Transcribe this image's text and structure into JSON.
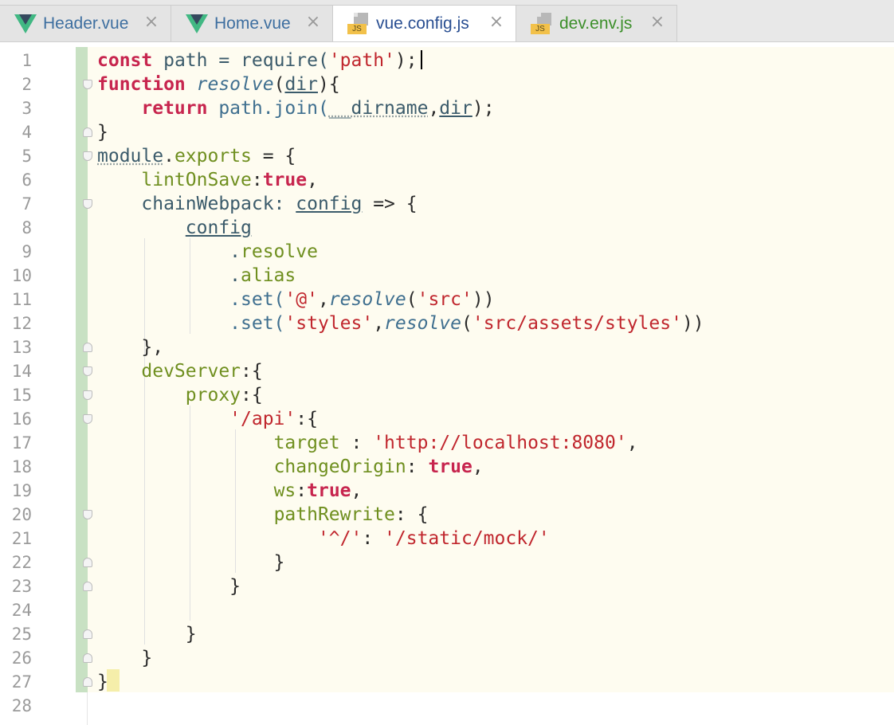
{
  "tabs": [
    {
      "label": "Header.vue",
      "icon": "vue-icon",
      "color": "#3e6fa0",
      "active": false
    },
    {
      "label": "Home.vue",
      "icon": "vue-icon",
      "color": "#3e6fa0",
      "active": false
    },
    {
      "label": "vue.config.js",
      "icon": "js-file-icon",
      "color": "#2a4f92",
      "active": true
    },
    {
      "label": "dev.env.js",
      "icon": "js-file-icon",
      "color": "#3c8f2a",
      "active": false
    }
  ],
  "close_glyph": "×",
  "js_badge": "JS",
  "line_numbers": [
    "1",
    "2",
    "3",
    "4",
    "5",
    "6",
    "7",
    "8",
    "9",
    "10",
    "11",
    "12",
    "13",
    "14",
    "15",
    "16",
    "17",
    "18",
    "19",
    "20",
    "21",
    "22",
    "23",
    "24",
    "25",
    "26",
    "27",
    "28"
  ],
  "code": {
    "l1": {
      "a": "const",
      "b": " path = require(",
      "c": "'path'",
      "d": ");"
    },
    "l2": {
      "a": "function",
      "b": " ",
      "c": "resolve",
      "d": "(",
      "e": "dir",
      "f": "){"
    },
    "l3": {
      "a": "    ",
      "b": "return",
      "c": " path.join(",
      "d": "__dirname",
      "e": ",",
      "f": "dir",
      "g": ");"
    },
    "l4": {
      "a": "}"
    },
    "l5": {
      "a": "module",
      "b": ".",
      "c": "exports",
      "d": " = {"
    },
    "l6": {
      "a": "    ",
      "b": "lintOnSave",
      "c": ":",
      "d": "true",
      "e": ","
    },
    "l7": {
      "a": "    chainWebpack: ",
      "b": "config",
      "c": " => {"
    },
    "l8": {
      "a": "        ",
      "b": "config"
    },
    "l9": {
      "a": "            .",
      "b": "resolve"
    },
    "l10": {
      "a": "            .",
      "b": "alias"
    },
    "l11": {
      "a": "            .set(",
      "b": "'@'",
      "c": ",",
      "d": "resolve",
      "e": "(",
      "f": "'src'",
      "g": "))"
    },
    "l12": {
      "a": "            .set(",
      "b": "'styles'",
      "c": ",",
      "d": "resolve",
      "e": "(",
      "f": "'src/assets/styles'",
      "g": "))"
    },
    "l13": {
      "a": "    },"
    },
    "l14": {
      "a": "    ",
      "b": "devServer",
      "c": ":{"
    },
    "l15": {
      "a": "        ",
      "b": "proxy",
      "c": ":{"
    },
    "l16": {
      "a": "            ",
      "b": "'/api'",
      "c": ":{"
    },
    "l17": {
      "a": "                ",
      "b": "target",
      "c": " : ",
      "d": "'http://localhost:8080'",
      "e": ","
    },
    "l18": {
      "a": "                ",
      "b": "changeOrigin",
      "c": ": ",
      "d": "true",
      "e": ","
    },
    "l19": {
      "a": "                ",
      "b": "ws",
      "c": ":",
      "d": "true",
      "e": ","
    },
    "l20": {
      "a": "                ",
      "b": "pathRewrite",
      "c": ": {"
    },
    "l21": {
      "a": "                    ",
      "b": "'^/'",
      "c": ": ",
      "d": "'/static/mock/'"
    },
    "l22": {
      "a": "                }"
    },
    "l23": {
      "a": "            }"
    },
    "l24": {
      "a": ""
    },
    "l25": {
      "a": "        }"
    },
    "l26": {
      "a": "    }"
    },
    "l27": {
      "a": "}"
    },
    "l28": {
      "a": ""
    }
  }
}
